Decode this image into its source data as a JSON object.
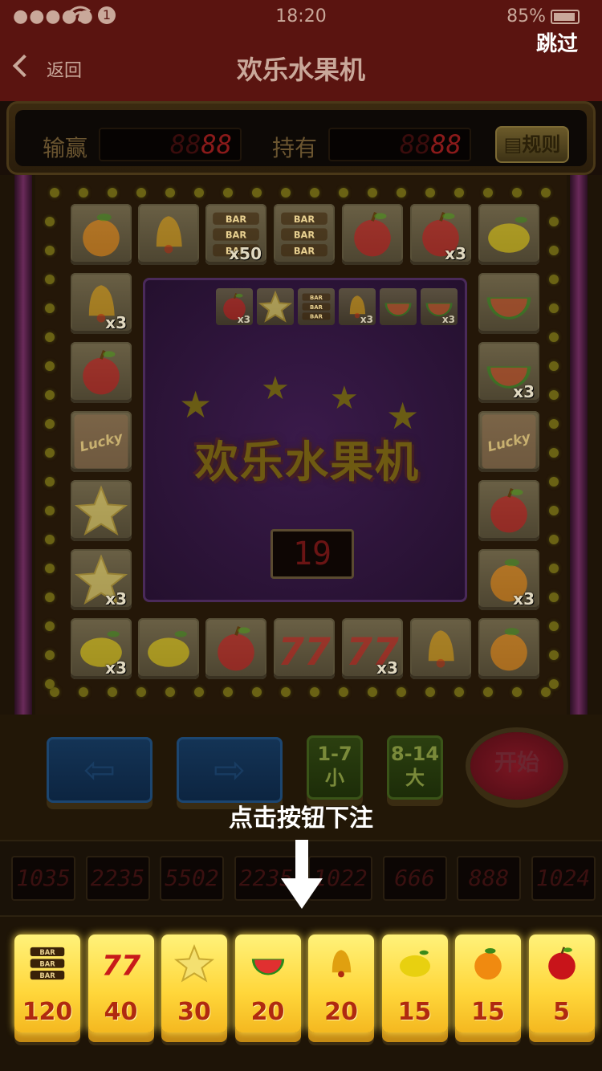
{
  "status": {
    "time": "18:20",
    "battery": "85%",
    "signal": "●●●●●",
    "info_glyph": "1"
  },
  "nav": {
    "back_label": "返回",
    "title": "欢乐水果机",
    "skip_label": "跳过"
  },
  "scorebar": {
    "win_label": "输赢",
    "win_value_dim": "88",
    "win_value_lit": "88",
    "hold_label": "持有",
    "hold_value_dim": "88",
    "hold_value_lit": "88",
    "rules_label": "规则"
  },
  "board": {
    "top_row": [
      {
        "icon": "orange",
        "mult": ""
      },
      {
        "icon": "bell",
        "mult": ""
      },
      {
        "icon": "bar",
        "mult": "x50"
      },
      {
        "icon": "bar",
        "mult": ""
      },
      {
        "icon": "apple",
        "mult": ""
      },
      {
        "icon": "apple",
        "mult": "x3"
      },
      {
        "icon": "lemon",
        "mult": ""
      }
    ],
    "left_col": [
      {
        "icon": "bell",
        "mult": "x3"
      },
      {
        "icon": "apple",
        "mult": ""
      },
      {
        "icon": "lucky",
        "mult": ""
      },
      {
        "icon": "star",
        "mult": ""
      },
      {
        "icon": "star",
        "mult": "x3"
      }
    ],
    "right_col": [
      {
        "icon": "watermelon",
        "mult": ""
      },
      {
        "icon": "watermelon",
        "mult": "x3"
      },
      {
        "icon": "lucky",
        "mult": ""
      },
      {
        "icon": "apple",
        "mult": ""
      },
      {
        "icon": "orange",
        "mult": "x3"
      }
    ],
    "bottom_row": [
      {
        "icon": "lemon",
        "mult": "x3"
      },
      {
        "icon": "lemon",
        "mult": ""
      },
      {
        "icon": "apple",
        "mult": ""
      },
      {
        "icon": "seven",
        "mult": ""
      },
      {
        "icon": "seven",
        "mult": "x3"
      },
      {
        "icon": "bell",
        "mult": ""
      },
      {
        "icon": "orange",
        "mult": ""
      }
    ],
    "center_history": [
      {
        "icon": "apple",
        "mult": "x3"
      },
      {
        "icon": "star",
        "mult": ""
      },
      {
        "icon": "bar",
        "mult": ""
      },
      {
        "icon": "bell",
        "mult": "x3"
      },
      {
        "icon": "watermelon",
        "mult": ""
      },
      {
        "icon": "watermelon",
        "mult": "x3"
      }
    ],
    "logo": "欢乐水果机",
    "counter": "19"
  },
  "controls": {
    "left_arrow": "⇦",
    "right_arrow": "⇨",
    "small": {
      "range": "1-7",
      "label": "小"
    },
    "big": {
      "range": "8-14",
      "label": "大"
    },
    "start": "开始",
    "hint": "点击按钮下注"
  },
  "leds": [
    "1035",
    "2235",
    "5502",
    "2235",
    "1022",
    "666",
    "888",
    "1024"
  ],
  "bets": [
    {
      "icon": "bar",
      "value": "120"
    },
    {
      "icon": "seven",
      "value": "40"
    },
    {
      "icon": "star",
      "value": "30"
    },
    {
      "icon": "watermelon",
      "value": "20"
    },
    {
      "icon": "bell",
      "value": "20"
    },
    {
      "icon": "lemon",
      "value": "15"
    },
    {
      "icon": "orange",
      "value": "15"
    },
    {
      "icon": "apple",
      "value": "5"
    }
  ],
  "colors": {
    "accent": "#ffd63a",
    "bet_value": "#b02a10",
    "nav_bg": "#5a1410"
  }
}
